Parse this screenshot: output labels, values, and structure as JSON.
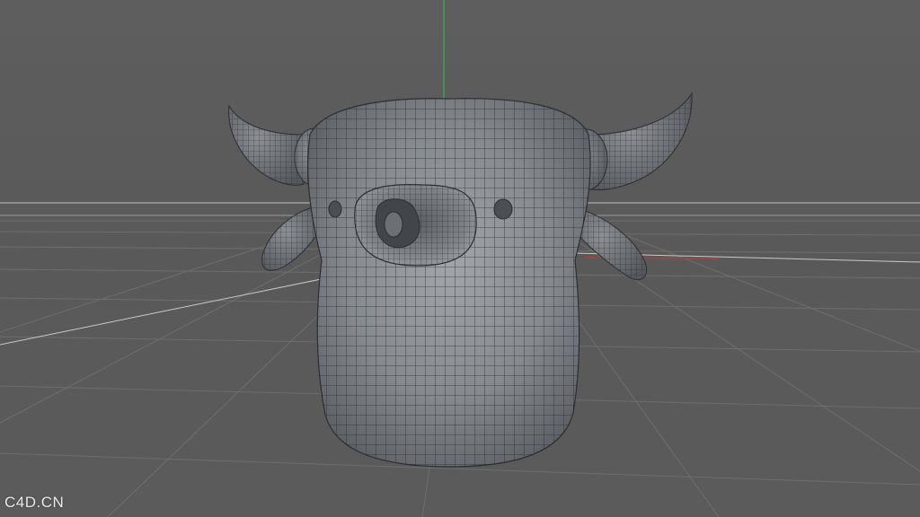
{
  "viewport": {
    "watermark": "C4D.CN"
  },
  "scene": {
    "object": "bull-head-mesh",
    "display_mode": "wireframe-over-gouraud",
    "colors": {
      "background": "#5c5c5c",
      "grid_line": "#6e6e6e",
      "horizon": "#c8c8c8",
      "mesh_fill": "#8a8e93",
      "mesh_wire": "#2c2e31",
      "axis_y": "#3fa34d",
      "axis_x": "#b83a3a"
    }
  }
}
